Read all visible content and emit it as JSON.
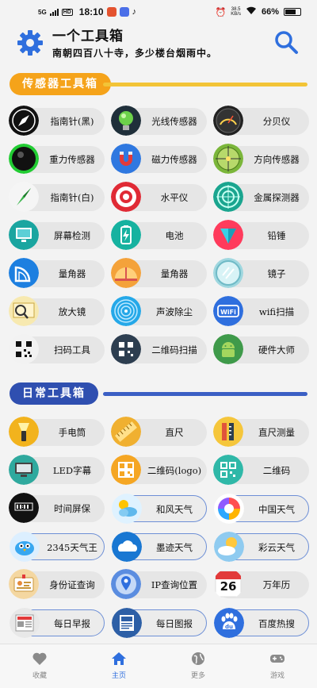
{
  "status": {
    "signal": "5G",
    "hd": "HD",
    "time": "18:10",
    "net_speed": "38.5",
    "net_unit": "KB/s",
    "battery": "66%"
  },
  "header": {
    "title": "一个工具箱",
    "subtitle": "南朝四百八十寺，多少楼台烟雨中。"
  },
  "colors": {
    "accent": "#2f6fde",
    "sensor_section": "#f5a31a",
    "daily_section": "#2f4fb0"
  },
  "sections": [
    {
      "title": "传感器工具箱",
      "items": [
        {
          "label": "指南针(黑)",
          "icon": "compass-black-icon"
        },
        {
          "label": "光线传感器",
          "icon": "light-bulb-icon"
        },
        {
          "label": "分贝仪",
          "icon": "decibel-meter-icon"
        },
        {
          "label": "重力传感器",
          "icon": "gravity-ball-icon"
        },
        {
          "label": "磁力传感器",
          "icon": "magnet-icon"
        },
        {
          "label": "方向传感器",
          "icon": "crosshair-icon"
        },
        {
          "label": "指南针(白)",
          "icon": "compass-white-icon"
        },
        {
          "label": "水平仪",
          "icon": "level-target-icon"
        },
        {
          "label": "金属探测器",
          "icon": "metal-detector-icon"
        },
        {
          "label": "屏幕检测",
          "icon": "monitor-icon"
        },
        {
          "label": "电池",
          "icon": "battery-icon"
        },
        {
          "label": "铅锤",
          "icon": "plumb-bob-icon"
        },
        {
          "label": "量角器",
          "icon": "protractor-icon"
        },
        {
          "label": "量角器",
          "icon": "protractor-half-icon"
        },
        {
          "label": "镜子",
          "icon": "mirror-icon"
        },
        {
          "label": "放大镜",
          "icon": "magnifier-icon"
        },
        {
          "label": "声波除尘",
          "icon": "sound-wave-icon"
        },
        {
          "label": "wifi扫描",
          "icon": "wifi-icon"
        },
        {
          "label": "扫码工具",
          "icon": "scan-code-icon"
        },
        {
          "label": "二维码扫描",
          "icon": "qr-scan-icon"
        },
        {
          "label": "硬件大师",
          "icon": "android-icon"
        }
      ]
    },
    {
      "title": "日常工具箱",
      "items": [
        {
          "label": "手电筒",
          "icon": "flashlight-icon"
        },
        {
          "label": "直尺",
          "icon": "ruler-icon"
        },
        {
          "label": "直尺测量",
          "icon": "ruler-measure-icon"
        },
        {
          "label": "LED字幕",
          "icon": "led-screen-icon"
        },
        {
          "label": "二维码(logo)",
          "icon": "qr-logo-icon"
        },
        {
          "label": "二维码",
          "icon": "qr-code-icon"
        },
        {
          "label": "时间屏保",
          "icon": "clock-screen-icon"
        },
        {
          "label": "和风天气",
          "icon": "weather-sun-cloud-icon"
        },
        {
          "label": "中国天气",
          "icon": "china-weather-icon"
        },
        {
          "label": "2345天气王",
          "icon": "weather-bird-icon"
        },
        {
          "label": "墨迹天气",
          "icon": "moji-weather-icon"
        },
        {
          "label": "彩云天气",
          "icon": "caiyun-weather-icon"
        },
        {
          "label": "身份证查询",
          "icon": "id-card-icon"
        },
        {
          "label": "IP查询位置",
          "icon": "location-pin-icon"
        },
        {
          "label": "万年历",
          "icon": "calendar-icon"
        },
        {
          "label": "每日早报",
          "icon": "newspaper-icon"
        },
        {
          "label": "每日图报",
          "icon": "picture-news-icon"
        },
        {
          "label": "百度热搜",
          "icon": "baidu-icon"
        }
      ]
    }
  ],
  "calendar_day": "26",
  "bottom_nav": [
    {
      "label": "收藏",
      "icon": "heart-icon"
    },
    {
      "label": "主页",
      "icon": "home-icon"
    },
    {
      "label": "更多",
      "icon": "globe-icon"
    },
    {
      "label": "游戏",
      "icon": "gamepad-icon"
    }
  ]
}
